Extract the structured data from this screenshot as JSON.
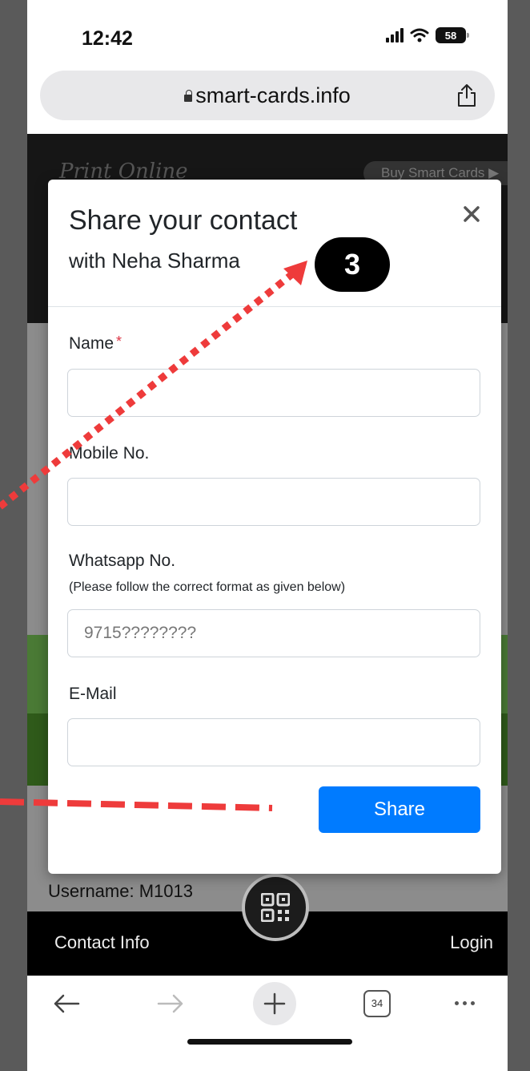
{
  "status_bar": {
    "time": "12:42",
    "battery": "58"
  },
  "browser": {
    "url": "smart-cards.info",
    "tab_count": "34"
  },
  "background_page": {
    "logo_text": "Print Online",
    "buy_button_label": "Buy Smart Cards ▶",
    "username": "Username: M1013",
    "footer_left": "Contact Info",
    "footer_right": "Login"
  },
  "modal": {
    "title": "Share your contact",
    "subtitle": "with Neha Sharma",
    "fields": {
      "name": {
        "label": "Name",
        "required_mark": "*",
        "value": ""
      },
      "mobile": {
        "label": "Mobile No.",
        "value": ""
      },
      "whatsapp": {
        "label": "Whatsapp No.",
        "hint": "(Please follow the correct format as given below)",
        "placeholder": "9715????????",
        "value": ""
      },
      "email": {
        "label": "E-Mail",
        "value": ""
      }
    },
    "submit_label": "Share"
  },
  "annotation": {
    "step_number": "3",
    "accent_color": "#ee3b3b"
  }
}
